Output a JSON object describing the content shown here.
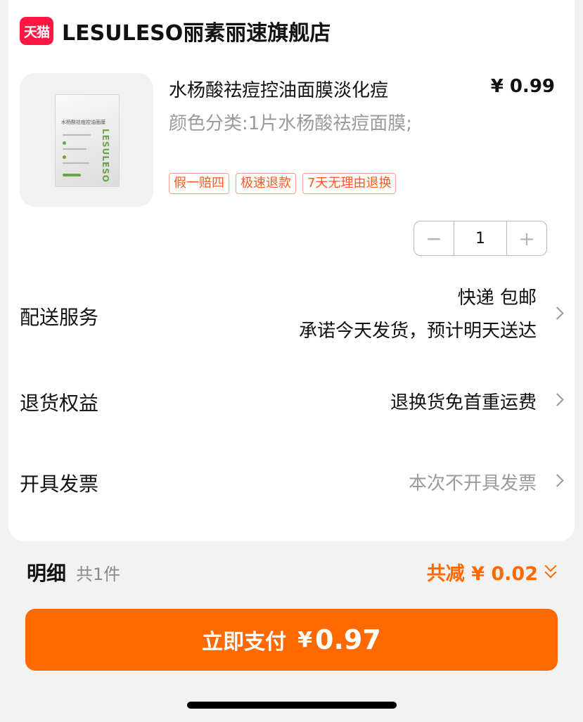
{
  "shop": {
    "badge": "天猫",
    "name": "LESULESO丽素丽速旗舰店"
  },
  "product": {
    "title": "水杨酸祛痘控油面膜淡化痘",
    "price": "¥ 0.99",
    "sku": "颜色分类:1片水杨酸祛痘面膜;",
    "image": {
      "brand_text": "LESULESO",
      "title_text": "水杨酸祛痘控油面膜"
    },
    "tags": [
      "假一赔四",
      "极速退款",
      "7天无理由退换"
    ]
  },
  "quantity": {
    "minus_icon": "−",
    "value": "1",
    "plus_icon": "+"
  },
  "rows": {
    "delivery": {
      "label": "配送服务",
      "line1": "快递 包邮",
      "line2": "承诺今天发货，预计明天送达"
    },
    "returns": {
      "label": "退货权益",
      "value": "退换货免首重运费"
    },
    "invoice": {
      "label": "开具发票",
      "value": "本次不开具发票"
    }
  },
  "detail": {
    "label": "明细",
    "count": "共1件",
    "discount": "共减 ¥ 0.02"
  },
  "pay": {
    "label": "立即支付",
    "yen": "¥",
    "amount": "0.97"
  },
  "colors": {
    "accent": "#ff6a00",
    "tmall": "#ff1744",
    "tag": "#ff5a1f"
  }
}
